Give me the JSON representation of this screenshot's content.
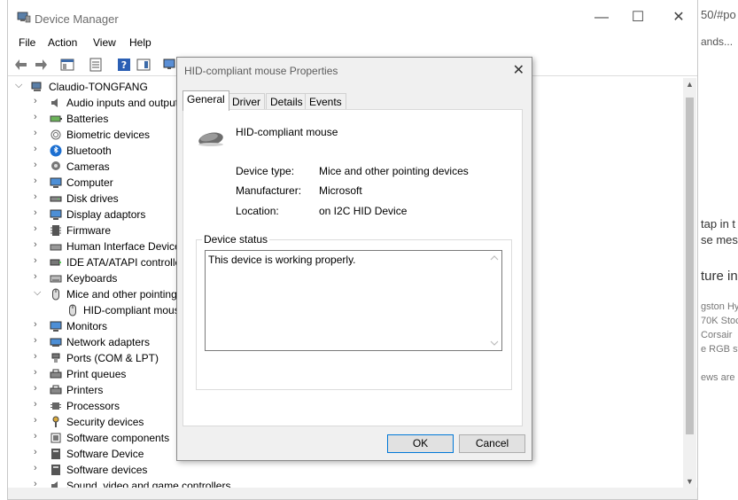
{
  "background": {
    "lines": [
      "50/#po",
      "ands...",
      "tap in t",
      "se mess",
      "ture in",
      "gston Hy",
      "70K Stoc",
      "Corsair",
      "e RGB st",
      "ews are r"
    ]
  },
  "window": {
    "title": "Device Manager",
    "minimize": "—",
    "maximize": "☐",
    "close": "✕"
  },
  "menu": [
    "File",
    "Action",
    "View",
    "Help"
  ],
  "tree": {
    "root": "Claudio-TONGFANG",
    "items": [
      "Audio inputs and outputs",
      "Batteries",
      "Biometric devices",
      "Bluetooth",
      "Cameras",
      "Computer",
      "Disk drives",
      "Display adaptors",
      "Firmware",
      "Human Interface Devices",
      "IDE ATA/ATAPI controllers",
      "Keyboards",
      "Mice and other pointing devices",
      "HID-compliant mouse",
      "Monitors",
      "Network adapters",
      "Ports (COM & LPT)",
      "Print queues",
      "Printers",
      "Processors",
      "Security devices",
      "Software components",
      "Software Device",
      "Software devices",
      "Sound, video and game controllers"
    ]
  },
  "dialog": {
    "title": "HID-compliant mouse Properties",
    "close": "✕",
    "tabs": [
      "General",
      "Driver",
      "Details",
      "Events"
    ],
    "device_name": "HID-compliant mouse",
    "device_type_label": "Device type:",
    "device_type": "Mice and other pointing devices",
    "manufacturer_label": "Manufacturer:",
    "manufacturer": "Microsoft",
    "location_label": "Location:",
    "location": "on I2C HID Device",
    "status_group": "Device status",
    "status_text": "This device is working properly.",
    "ok": "OK",
    "cancel": "Cancel"
  },
  "colors": {
    "accent": "#0078d7",
    "folder": "#d8a93c"
  }
}
